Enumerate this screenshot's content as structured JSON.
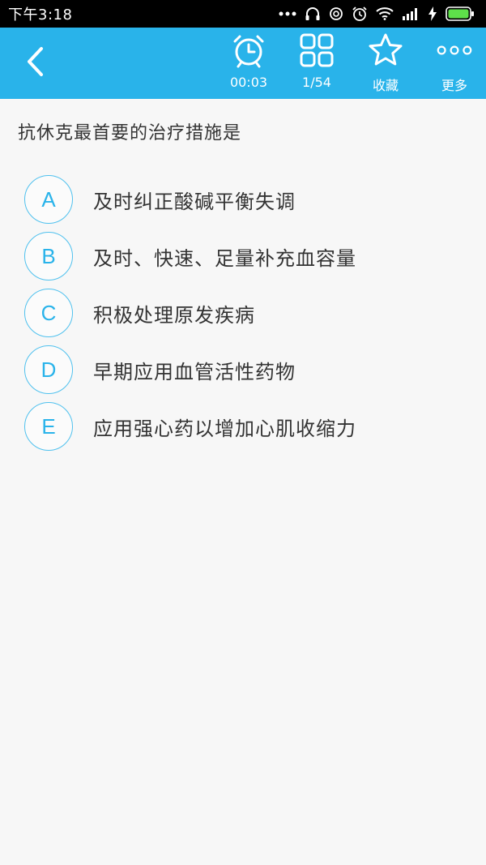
{
  "status_bar": {
    "time": "下午3:18",
    "icons": [
      "more-dots-icon",
      "headphones-icon",
      "sync-icon",
      "alarm-icon",
      "wifi-icon",
      "signal-icon",
      "charging-icon",
      "battery-icon"
    ]
  },
  "toolbar": {
    "back_icon": "back-chevron-icon",
    "timer": {
      "icon": "alarm-clock-icon",
      "label": "00:03"
    },
    "progress": {
      "icon": "grid-icon",
      "label": "1/54"
    },
    "favorite": {
      "icon": "star-icon",
      "label": "收藏"
    },
    "more": {
      "icon": "more-dots-icon",
      "label": "更多"
    }
  },
  "question": {
    "text": "抗休克最首要的治疗措施是",
    "options": [
      {
        "letter": "A",
        "text": "及时纠正酸碱平衡失调"
      },
      {
        "letter": "B",
        "text": "及时、快速、足量补充血容量"
      },
      {
        "letter": "C",
        "text": "积极处理原发疾病"
      },
      {
        "letter": "D",
        "text": "早期应用血管活性药物"
      },
      {
        "letter": "E",
        "text": "应用强心药以增加心肌收缩力"
      }
    ]
  },
  "colors": {
    "accent": "#29b3ea",
    "option_border": "#4fc1ee",
    "background": "#f7f7f7",
    "text": "#333333"
  }
}
